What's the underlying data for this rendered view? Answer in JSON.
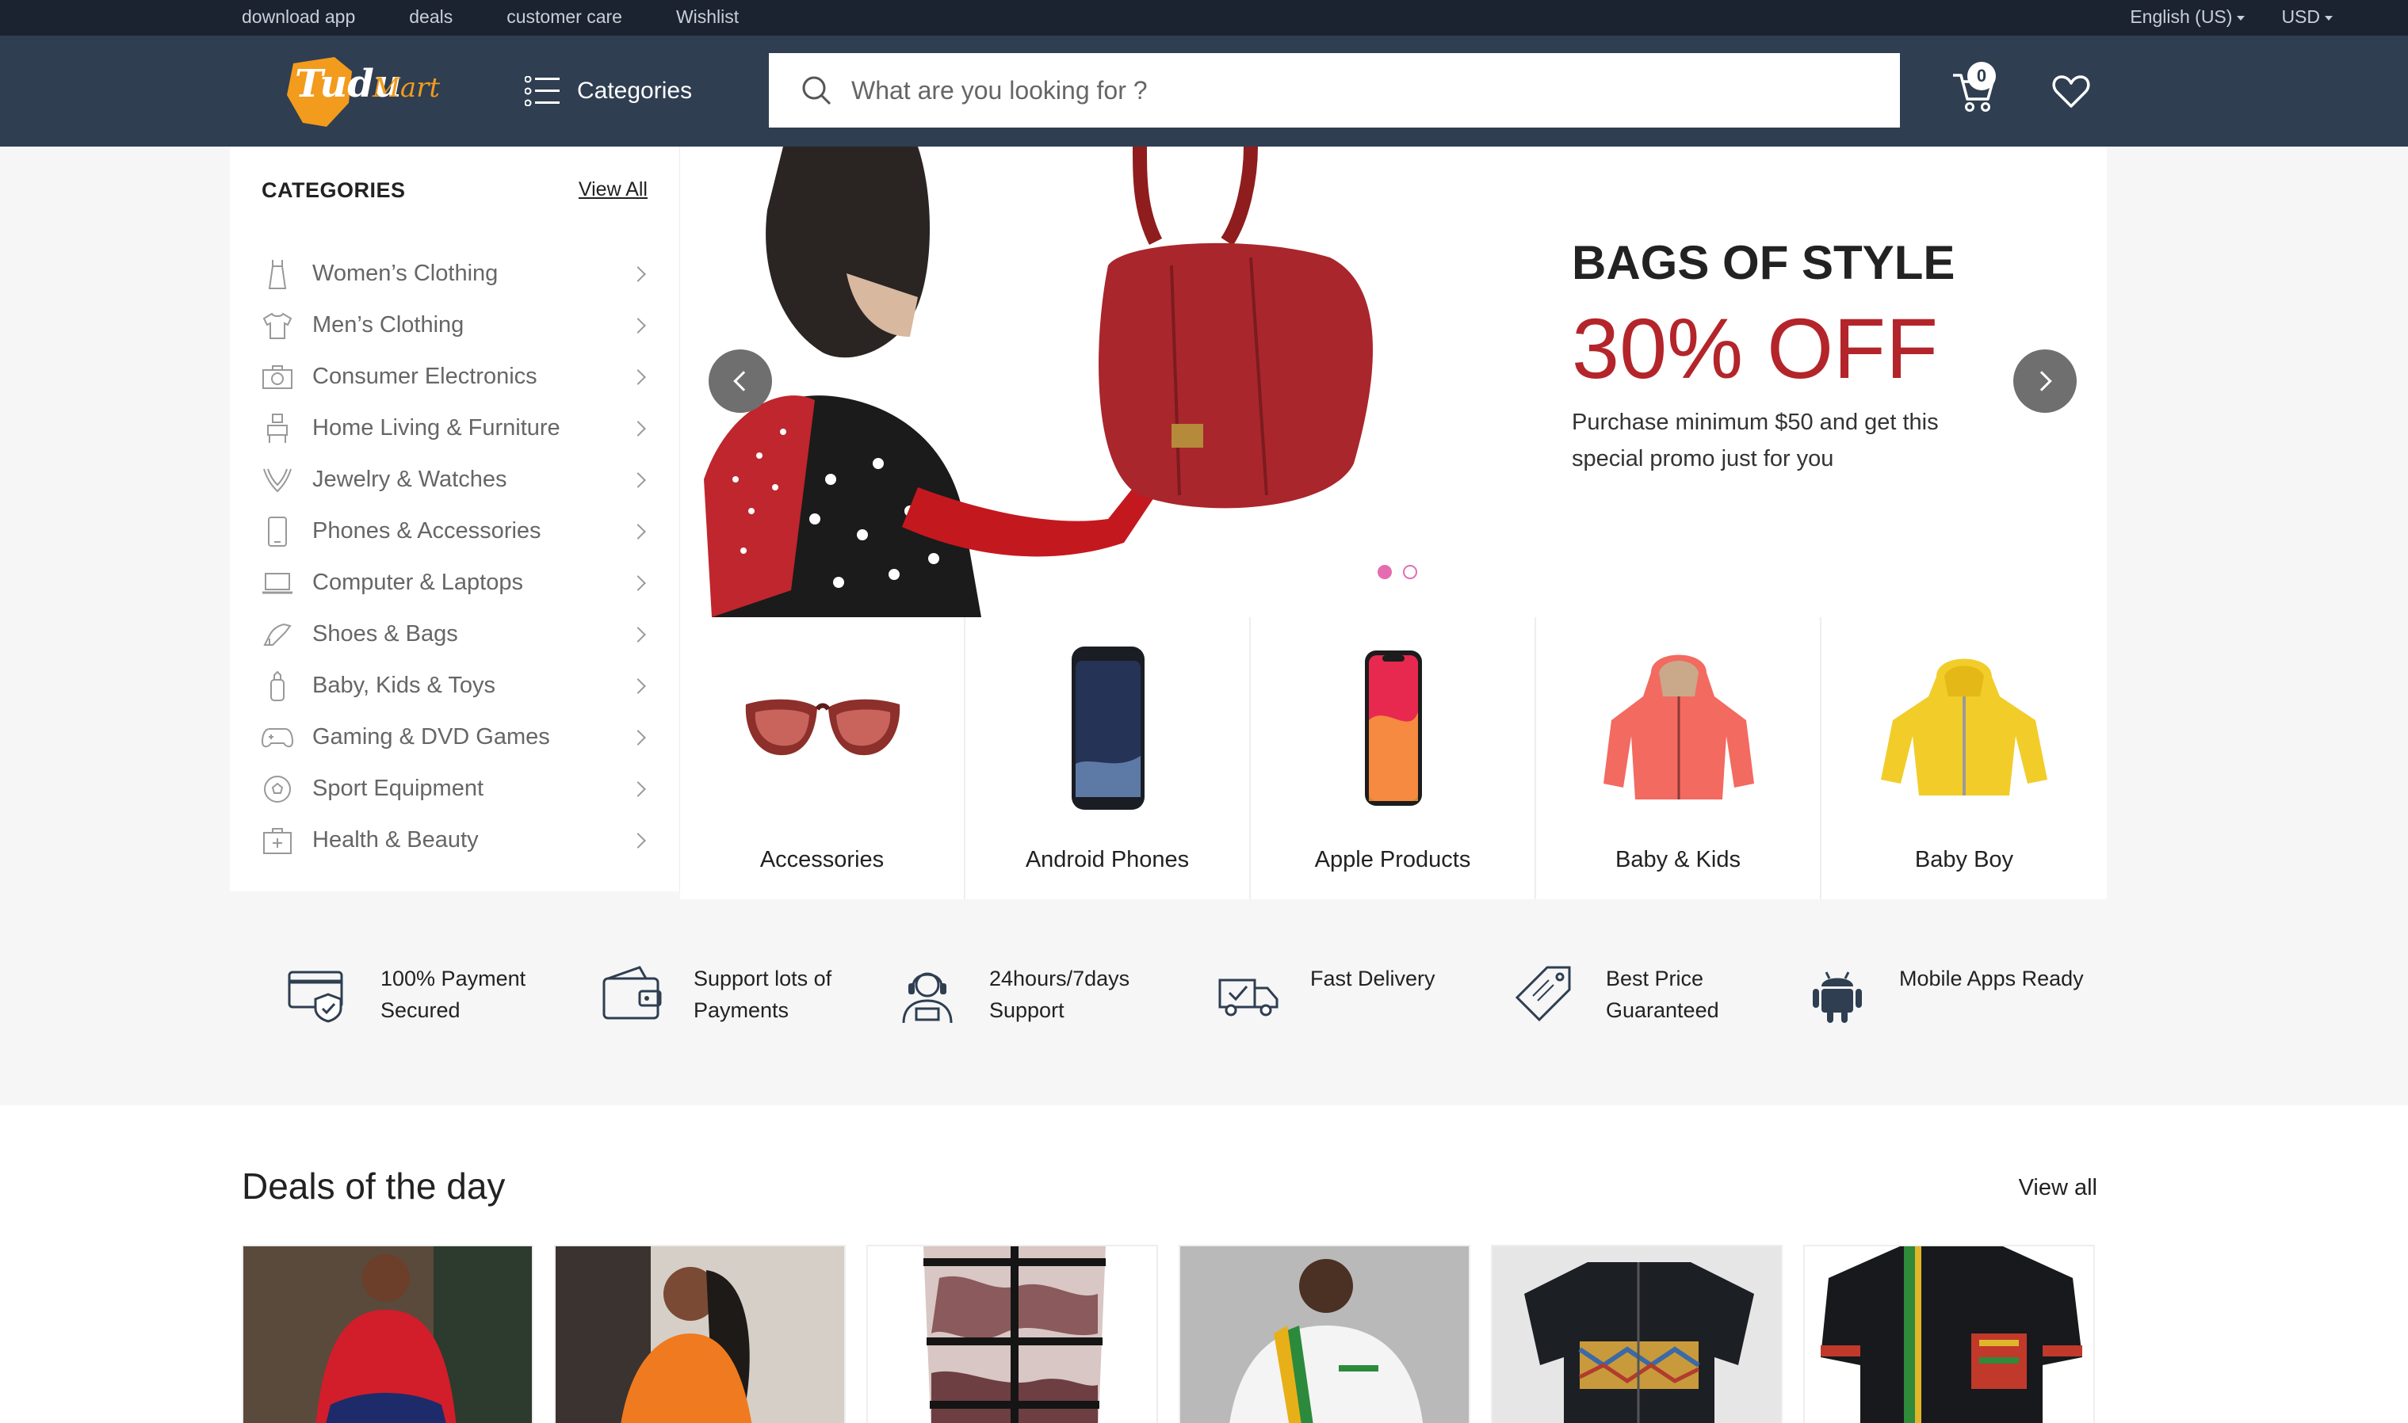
{
  "topbar": {
    "links": [
      "download app",
      "deals",
      "customer care",
      "Wishlist"
    ],
    "language": "English (US)",
    "currency": "USD"
  },
  "header": {
    "logo_text": "TuduMart",
    "categories_label": "Categories",
    "search_placeholder": "What are you looking for ?",
    "cart_count": "0"
  },
  "sidebar": {
    "title": "CATEGORIES",
    "view_all": "View All",
    "items": [
      {
        "label": "Women’s Clothing",
        "icon": "dress-icon"
      },
      {
        "label": "Men’s Clothing",
        "icon": "shirt-icon"
      },
      {
        "label": "Consumer Electronics",
        "icon": "camera-icon"
      },
      {
        "label": "Home Living & Furniture",
        "icon": "furniture-icon"
      },
      {
        "label": "Jewelry & Watches",
        "icon": "necklace-icon"
      },
      {
        "label": "Phones & Accessories",
        "icon": "phone-icon"
      },
      {
        "label": "Computer & Laptops",
        "icon": "laptop-icon"
      },
      {
        "label": "Shoes & Bags",
        "icon": "heel-icon"
      },
      {
        "label": "Baby, Kids & Toys",
        "icon": "bottle-icon"
      },
      {
        "label": "Gaming & DVD Games",
        "icon": "gamepad-icon"
      },
      {
        "label": "Sport Equipment",
        "icon": "ball-icon"
      },
      {
        "label": "Health & Beauty",
        "icon": "health-icon"
      }
    ]
  },
  "banner": {
    "title": "BAGS OF STYLE",
    "discount": "30% OFF",
    "text": "Purchase minimum $50 and get this special promo just for you",
    "slides": 2,
    "active_slide": 1
  },
  "tiles": [
    {
      "label": "Accessories"
    },
    {
      "label": "Android Phones"
    },
    {
      "label": "Apple Products"
    },
    {
      "label": "Baby & Kids"
    },
    {
      "label": "Baby Boy"
    }
  ],
  "features": [
    {
      "text": "100% Payment Secured",
      "icon": "secure-card-icon"
    },
    {
      "text": "Support lots of Payments",
      "icon": "wallet-icon"
    },
    {
      "text": "24hours/7days Support",
      "icon": "support-agent-icon"
    },
    {
      "text": "Fast Delivery",
      "icon": "truck-icon"
    },
    {
      "text": "Best Price Guaranteed",
      "icon": "price-tag-icon"
    },
    {
      "text": "Mobile Apps Ready",
      "icon": "android-icon"
    }
  ],
  "deals": {
    "title": "Deals of the day",
    "view_all": "View all"
  },
  "colors": {
    "topbar": "#1b2330",
    "header": "#2f3e51",
    "accent_red": "#b3252a",
    "dot_pink": "#e46db1"
  }
}
